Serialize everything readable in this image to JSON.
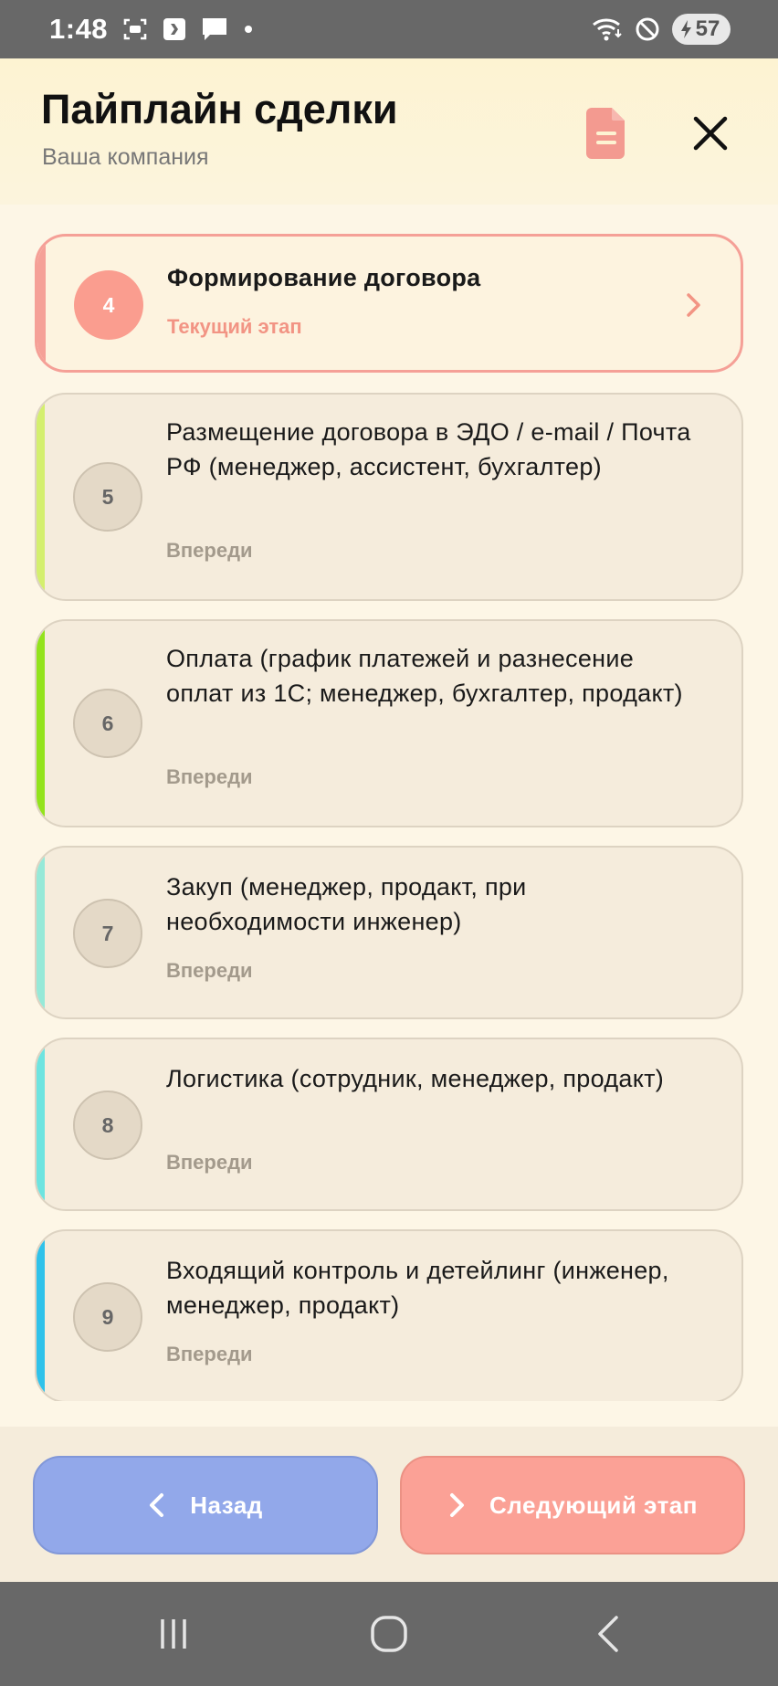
{
  "status_bar": {
    "time": "1:48",
    "battery": "57",
    "left_icons": [
      "screenshot-icon",
      "music-app-icon",
      "message-icon",
      "dot-icon"
    ],
    "right_icons": [
      "wifi-icon",
      "do-not-disturb-icon",
      "battery-icon"
    ]
  },
  "header": {
    "title": "Пайплайн сделки",
    "subtitle": "Ваша компания",
    "doc_icon": "document-icon",
    "close_icon": "close-icon",
    "accent_color": "#f39a90"
  },
  "stages": [
    {
      "number": "4",
      "name": "Формирование договора",
      "status": "Текущий этап",
      "current": true,
      "accent": "#f5a097"
    },
    {
      "number": "5",
      "name": "Размещение договора в ЭДО / e-mail / Почта РФ (менеджер, ассистент, бухгалтер)",
      "status": "Впереди",
      "current": false,
      "accent": "#d4ef6e"
    },
    {
      "number": "6",
      "name": "Оплата (график платежей и разнесение оплат из 1С; менеджер, бухгалтер, продакт)",
      "status": "Впереди",
      "current": false,
      "accent": "#93e31c"
    },
    {
      "number": "7",
      "name": "Закуп (менеджер, продакт, при необходимости инженер)",
      "status": "Впереди",
      "current": false,
      "accent": "#96e9d8"
    },
    {
      "number": "8",
      "name": "Логистика (сотрудник, менеджер, продакт)",
      "status": "Впереди",
      "current": false,
      "accent": "#6de4e0"
    },
    {
      "number": "9",
      "name": "Входящий контроль и детейлинг (инженер, менеджер, продакт)",
      "status": "Впереди",
      "current": false,
      "accent": "#2fc2ea"
    }
  ],
  "footer": {
    "back_label": "Назад",
    "next_label": "Следующий этап",
    "back_color": "#92a8ea",
    "next_color": "#fba196"
  },
  "nav_bar": {
    "icons": [
      "recent-apps-icon",
      "home-icon",
      "back-icon"
    ]
  }
}
